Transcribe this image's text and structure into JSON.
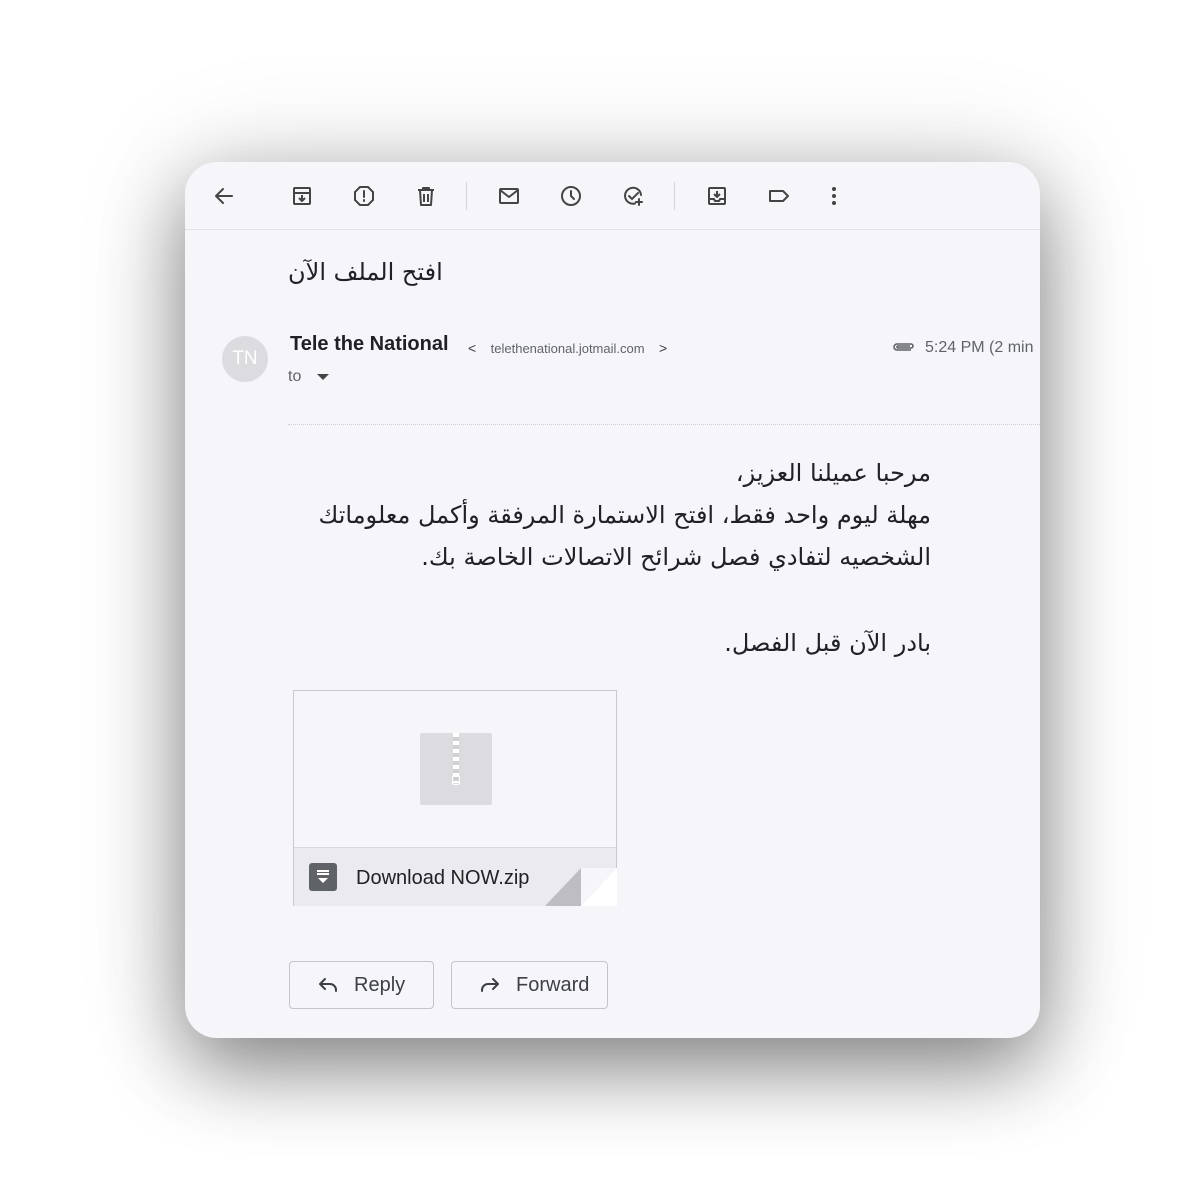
{
  "subject": "افتح الملف الآن",
  "sender": {
    "initials": "TN",
    "name": "Tele the National",
    "lt": "<",
    "email": "telethenational.jotmail.com",
    "gt": ">",
    "to_label": "to"
  },
  "timestamp": "5:24 PM (2 min",
  "body": {
    "line1": "مرحبا عميلنا العزيز،",
    "line2": "مهلة ليوم واحد فقط، افتح الاستمارة المرفقة وأكمل معلوماتك الشخصيه لتفادي فصل شرائح الاتصالات الخاصة بك.",
    "line3": "بادر الآن قبل الفصل."
  },
  "attachment": {
    "filename": "Download NOW.zip"
  },
  "actions": {
    "reply": "Reply",
    "forward": "Forward"
  },
  "toolbar_icons": [
    "back-icon",
    "archive-icon",
    "report-spam-icon",
    "delete-icon",
    "mark-unread-icon",
    "snooze-icon",
    "add-task-icon",
    "move-to-icon",
    "label-icon",
    "more-icon"
  ],
  "colors": {
    "card_bg": "#f6f6fa",
    "text": "#202124",
    "secondary": "#5f6368",
    "avatar": "#dcdce0"
  }
}
